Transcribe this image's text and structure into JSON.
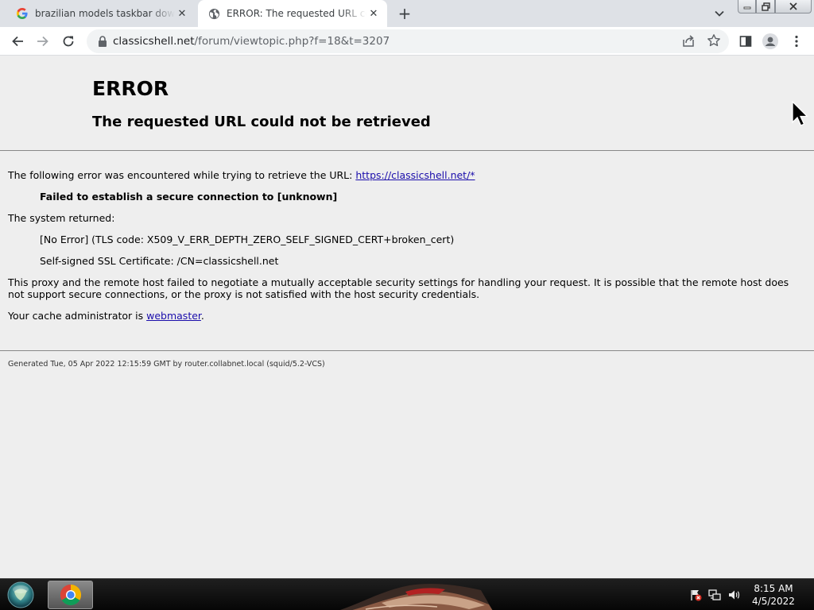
{
  "browser": {
    "tabs": [
      {
        "title": "brazilian models taskbar downlo",
        "favicon": "google-icon",
        "active": false
      },
      {
        "title": "ERROR: The requested URL could",
        "favicon": "globe-icon",
        "active": true
      }
    ],
    "url_domain": "classicshell.net",
    "url_path": "/forum/viewtopic.php?f=18&t=3207"
  },
  "page": {
    "h1": "ERROR",
    "h2": "The requested URL could not be retrieved",
    "intro_text": "The following error was encountered while trying to retrieve the URL: ",
    "intro_link": "https://classicshell.net/*",
    "error_heading": "Failed to establish a secure connection to [unknown]",
    "system_returned": "The system returned:",
    "tls_code": "[No Error] (TLS code: X509_V_ERR_DEPTH_ZERO_SELF_SIGNED_CERT+broken_cert)",
    "cert_line": "Self-signed SSL Certificate: /CN=classicshell.net",
    "explanation": "This proxy and the remote host failed to negotiate a mutually acceptable security settings for handling your request. It is possible that the remote host does not support secure connections, or the proxy is not satisfied with the host security credentials.",
    "admin_prefix": "Your cache administrator is ",
    "admin_link": "webmaster",
    "admin_suffix": ".",
    "footer": "Generated Tue, 05 Apr 2022 12:15:59 GMT by router.collabnet.local (squid/5.2-VCS)"
  },
  "taskbar": {
    "time": "8:15 AM",
    "date": "4/5/2022"
  }
}
